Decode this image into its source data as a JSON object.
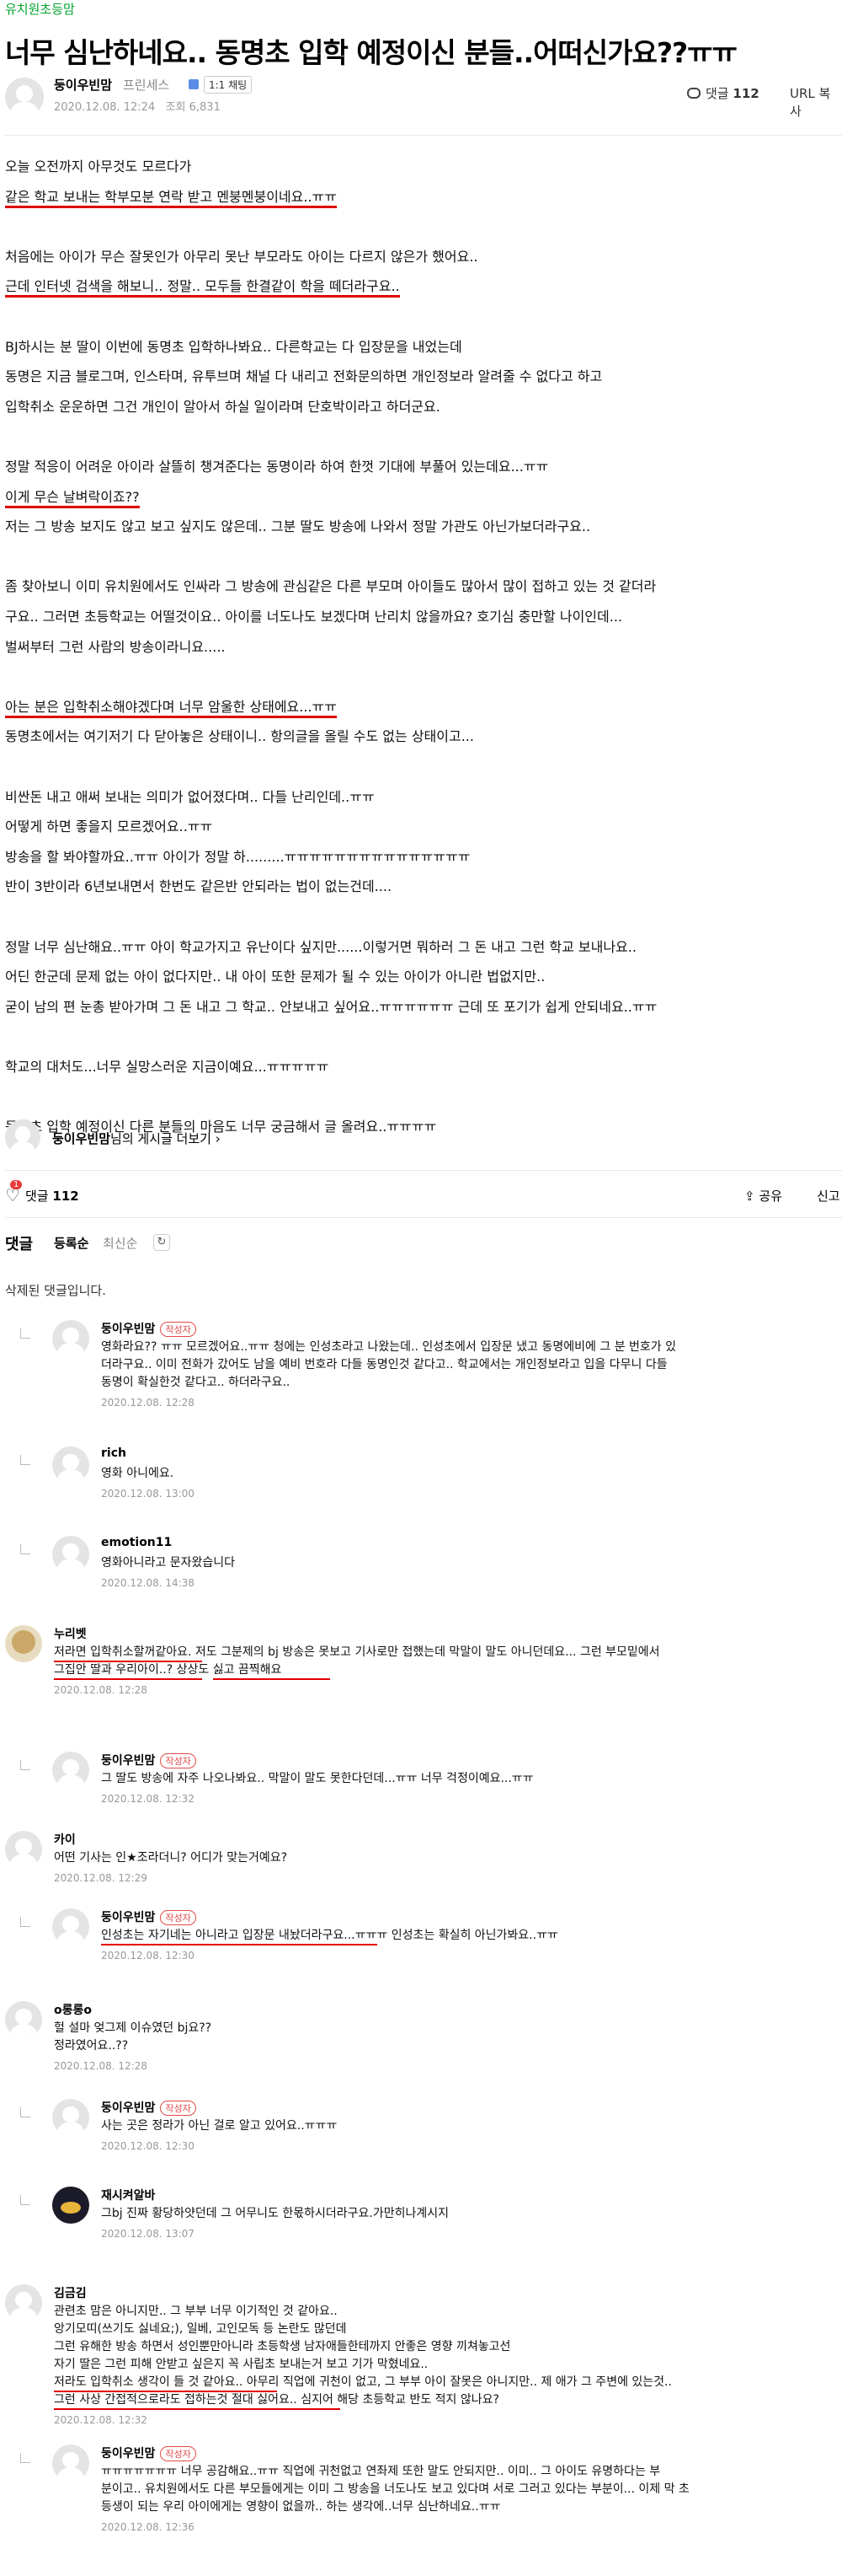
{
  "board": "유치원초등맘",
  "title": "너무 심난하네요.. 동명초 입학 예정이신 분들..어떠신가요??ㅠㅠ",
  "author": {
    "name": "둥이우빈맘",
    "level": "프린세스",
    "chat": "1:1 채팅",
    "date": "2020.12.08. 12:24",
    "views": "조회 6,831"
  },
  "top_actions": {
    "comment_label": "댓글",
    "comment_count": "112",
    "url_copy": "URL 복사"
  },
  "body": [
    "오늘 오전까지 아무것도 모르다가",
    "같은 학교 보내는 학부모분 연락 받고 멘붕멘붕이네요..ㅠㅠ",
    "",
    "처음에는 아이가 무슨 잘못인가 아무리 못난 부모라도 아이는 다르지 않은가 했어요..",
    "근데 인터넷 검색을 해보니.. 정말.. 모두들 한결같이 학을 떼더라구요..",
    "",
    "BJ하시는 분 딸이 이번에 동명초 입학하나봐요.. 다른학교는 다 입장문을 내었는데",
    "동명은 지금 블로그며, 인스타며, 유투브며 채널 다 내리고 전화문의하면 개인정보라 알려줄 수 없다고 하고",
    "입학취소 운운하면 그건 개인이 알아서 하실 일이라며 단호박이라고 하더군요.",
    "",
    "정말 적응이 어려운 아이라 살뜰히 챙겨준다는 동명이라 하여 한껏 기대에 부풀어 있는데요...ㅠㅠ",
    "이게 무슨 날벼락이죠??",
    "저는 그 방송 보지도 않고 보고 싶지도 않은데.. 그분 딸도 방송에 나와서 정말 가관도 아닌가보더라구요..",
    "",
    "좀 찾아보니 이미 유치원에서도 인싸라 그 방송에 관심같은 다른 부모며 아이들도 많아서 많이 접하고 있는 것 같더라",
    "구요.. 그러면 초등학교는 어떨것이요.. 아이를 너도나도 보겠다며 난리치 않을까요? 호기심 충만할 나이인데...",
    "벌써부터 그런 사람의 방송이라니요.....",
    "",
    "아는 분은 입학취소해야겠다며 너무 암울한 상태에요...ㅠㅠ",
    "동명초에서는 여기저기 다 닫아놓은 상태이니.. 항의글을 올릴 수도 없는 상태이고...",
    "",
    "비싼돈 내고 애써 보내는 의미가 없어졌다며.. 다들 난리인데..ㅠㅠ",
    "어떻게 하면 좋을지 모르겠어요..ㅠㅠ",
    "방송을 할 봐야할까요..ㅠㅠ 아이가 정말 하.........ㅠㅠㅠㅠㅠㅠㅠㅠㅠㅠㅠㅠㅠㅠㅠ",
    "반이 3반이라 6년보내면서 한번도 같은반 안되라는 법이 없는건데....",
    "",
    "정말 너무 심난해요..ㅠㅠ 아이 학교가지고 유난이다 싶지만......이렇거면 뭐하러 그 돈 내고 그런 학교 보내나요..",
    "어딘 한군데 문제 없는 아이 없다지만.. 내 아이 또한 문제가 될 수 있는 아이가 아니란 법없지만..",
    "굳이 남의 편 눈총 받아가며 그 돈 내고 그 학교.. 안보내고 싶어요..ㅠㅠㅠㅠㅠㅠ 근데 또 포기가 쉽게 안되네요..ㅠㅠ",
    "",
    "학교의 대처도...너무 실망스러운 지금이예요...ㅠㅠㅠㅠㅠ",
    "",
    "동명초 입학 예정이신 다른 분들의 마음도 너무 궁금해서 글 올려요..ㅠㅠㅠㅠ"
  ],
  "body_underline": {
    "line1": "같은 학교 보내는 학부모분 연락 받고 멘붕멘붕이네요..ㅠㅠ",
    "line4a": "근데 인터넷 검색을 해보니.. ",
    "line4b": "정말.. 모두들 한결같이 학을 떼더라구요..",
    "line11": "이게 무슨 날벼락이죠??",
    "line18": "아는 분은 입학취소해야겠다며 너무 암울한 상태에요...ㅠㅠ"
  },
  "profile_link": {
    "name": "둥이우빈맘",
    "suffix": "님의 게시글 더보기 ›"
  },
  "action_bar": {
    "like_count": "1",
    "comment_label": "댓글",
    "comment_count": "112",
    "share": "공유",
    "report": "신고"
  },
  "comment_header": {
    "title": "댓글",
    "sort_registered": "등록순",
    "sort_latest": "최신순",
    "refresh_icon": "↻"
  },
  "deleted_comment": "삭제된 댓글입니다.",
  "badge_label": "작성자",
  "comments": [
    {
      "name": "둥이우빈맘",
      "author": true,
      "reply": true,
      "text": "영화라요?? ㅠㅠ 모르겠어요..ㅠㅠ 청에는 인성초라고 나왔는데.. 인성초에서 입장문 냈고 동명에비에 그 분 번호가 있\n더라구요.. 이미 전화가 갔어도 남을 예비 번호라 다들 동명인것 같다고.. 학교에서는 개인정보라고 입을 다무니 다들\n동명이 확실한것 같다고.. 하더라구요..",
      "date": "2020.12.08. 12:28"
    },
    {
      "name": "rich",
      "author": false,
      "reply": true,
      "text": "영화 아니에요.",
      "date": "2020.12.08. 13:00"
    },
    {
      "name": "emotion11",
      "author": false,
      "reply": true,
      "text": "영화아니라고 문자왔습니다",
      "date": "2020.12.08. 14:38"
    },
    {
      "name": "누리벳",
      "author": false,
      "reply": false,
      "text": "저라면 입학취소할꺼같아요. 저도 그분제의 bj 방송은 못보고 기사로만 접했는데 막말이 말도 아니던데요... 그런 부모밑에서\n그집안 딸과 우리아이..? 상상도 싫고 끔찍해요",
      "date": "2020.12.08. 12:28"
    },
    {
      "name": "둥이우빈맘",
      "author": true,
      "reply": true,
      "text": "그 딸도 방송에 자주 나오나봐요.. 막말이 말도 못한다던데...ㅠㅠ 너무 걱정이예요...ㅠㅠ",
      "date": "2020.12.08. 12:32"
    },
    {
      "name": "카이",
      "author": false,
      "reply": false,
      "text": "어떤 기사는 인★조라더니? 어디가 맞는거예요?",
      "date": "2020.12.08. 12:29"
    },
    {
      "name": "둥이우빈맘",
      "author": true,
      "reply": true,
      "text": "인성초는 자기네는 아니라고 입장문 내놨더라구요...ㅠㅠㅠ 인성초는 확실히 아닌가봐요..ㅠㅠ",
      "date": "2020.12.08. 12:30"
    },
    {
      "name": "o롱롱o",
      "author": false,
      "reply": false,
      "text": "헐 설마 엊그제 이슈였던 bj요??\n정라였어요..??",
      "date": "2020.12.08. 12:28"
    },
    {
      "name": "둥이우빈맘",
      "author": true,
      "reply": true,
      "text": "사는 곳은 정라가 아닌 걸로 알고 있어요..ㅠㅠㅠ",
      "date": "2020.12.08. 12:30"
    },
    {
      "name": "재시켜알바",
      "author": false,
      "reply": true,
      "text": "그bj 진짜 황당하얏던데 그 어무니도 한몫하시더라구요.가만히나계시지",
      "date": "2020.12.08. 13:07"
    },
    {
      "name": "김금김",
      "author": false,
      "reply": false,
      "text": "관련초 맘은 아니지만.. 그 부부 너무 이기적인 것 같아요..\n앙기모띠(쓰기도 싫네요;), 일베, 고인모독 등 논란도 많던데\n그런 유해한 방송 하면서 성인뿐만아니라 초등학생 남자애들한테까지 안좋은 영향 끼쳐놓고선\n자기 딸은 그런 피해 안받고 싶은지 꼭 사립초 보내는거 보고 기가 막혔네요..\n저라도 입학취소 생각이 들 것 같아요.. 아무리 직업에 귀천이 없고, 그 부부 아이 잘못은 아니지만.. 제 애가 그 주변에 있는것..\n그런 사상 간접적으로라도 접하는것 절대 싫어요.. 심지어 해당 초등학교 반도 적지 않나요?",
      "date": "2020.12.08. 12:32"
    },
    {
      "name": "둥이우빈맘",
      "author": true,
      "reply": true,
      "text": "ㅠㅠㅠㅠㅠㅠㅠ 너무 공감해요..ㅠㅠ 직업에 귀천없고 연좌제 또한 말도 안되지만.. 이미.. 그 아이도 유명하다는 부\n분이고.. 유치원에서도 다른 부모들에게는 이미 그 방송을 너도나도 보고 있다며 서로 그러고 있다는 부분이... 이제 막 초\n등생이 되는 우리 아이에게는 영향이 없을까.. 하는 생각에..너무 심난하네요..ㅠㅠ",
      "date": "2020.12.08. 12:36"
    }
  ]
}
